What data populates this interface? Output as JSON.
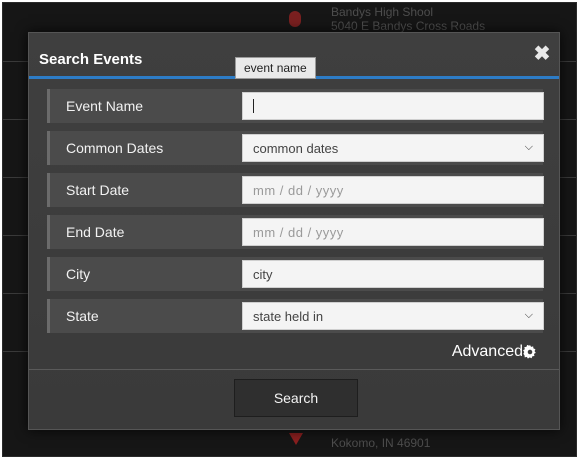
{
  "background": {
    "top_listing": {
      "name": "Bandys High Shool",
      "address": "5040 E Bandys Cross Roads"
    },
    "bottom_listing": {
      "address": "Kokomo, IN 46901"
    }
  },
  "modal": {
    "title": "Search Events",
    "tooltip": "event name",
    "fields": [
      {
        "label": "Event Name",
        "type": "text",
        "value": "",
        "placeholder": ""
      },
      {
        "label": "Common Dates",
        "type": "select",
        "selected": "common dates"
      },
      {
        "label": "Start Date",
        "type": "date",
        "placeholder": "mm  /  dd  /  yyyy"
      },
      {
        "label": "End Date",
        "type": "date",
        "placeholder": "mm  /  dd  /  yyyy"
      },
      {
        "label": "City",
        "type": "text",
        "value": "city"
      },
      {
        "label": "State",
        "type": "select",
        "selected": "state held in"
      }
    ],
    "advanced_label": "Advanced",
    "search_label": "Search"
  },
  "colors": {
    "accent": "#2d7cc6",
    "modal_bg": "#3d3d3d",
    "row_bg": "#4b4b4b"
  }
}
